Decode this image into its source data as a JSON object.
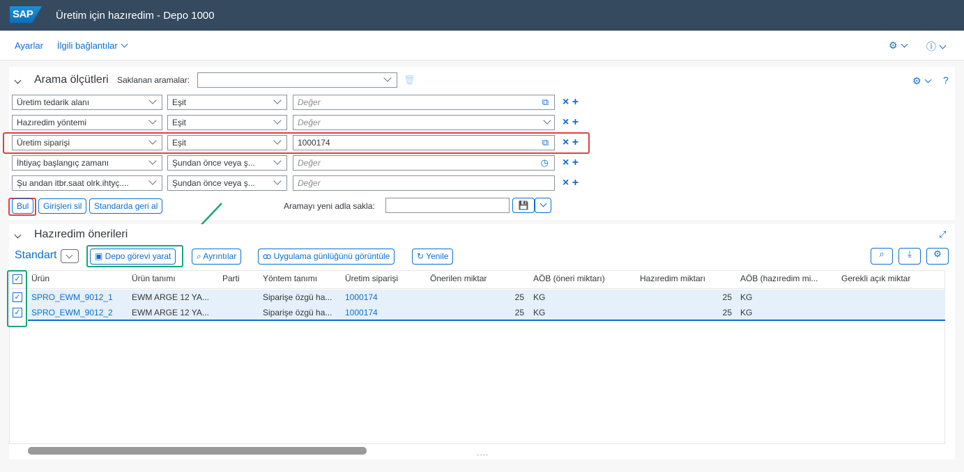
{
  "shell": {
    "logo": "SAP",
    "title": "Üretim için hazıredim - Depo 1000"
  },
  "menu": {
    "settings": "Ayarlar",
    "related": "İlgili bağlantılar"
  },
  "filter": {
    "title": "Arama ölçütleri",
    "saved_label": "Saklanan aramalar:",
    "rows": [
      {
        "field": "Üretim tedarik alanı",
        "op": "Eşit",
        "value": "",
        "placeholder": "Değer"
      },
      {
        "field": "Hazıredim yöntemi",
        "op": "Eşit",
        "value": "",
        "placeholder": "Değer"
      },
      {
        "field": "Üretim siparişi",
        "op": "Eşit",
        "value": "1000174",
        "placeholder": ""
      },
      {
        "field": "İhtiyaç başlangıç zamanı",
        "op": "Şundan önce veya ş...",
        "value": "",
        "placeholder": "Değer"
      },
      {
        "field": "Şu andan itbr.saat olrk.ihtyç....",
        "op": "Şundan önce veya ş...",
        "value": "",
        "placeholder": "Değer"
      }
    ],
    "find_btn": "Bul",
    "clear_btn": "Girişleri sil",
    "reset_btn": "Standarda geri al",
    "save_as_label": "Aramayı yeni adla sakla:"
  },
  "results": {
    "title": "Hazıredim önerileri",
    "variant": "Standart",
    "buttons": {
      "create": "Depo görevi yarat",
      "details": "Ayrıntılar",
      "log": "Uygulama günlüğünü görüntüle",
      "refresh": "Yenile"
    },
    "columns": [
      "Ürün",
      "Ürün tanımı",
      "Parti",
      "Yöntem tanımı",
      "Üretim siparişi",
      "Önerilen miktar",
      "AÖB (öneri miktarı)",
      "Hazıredim miktarı",
      "AÖB (hazıredim mi...",
      "Gerekli açık miktar"
    ],
    "rows": [
      {
        "product": "SPRO_EWM_9012_1",
        "desc": "EWM ARGE 12 YA...",
        "batch": "",
        "method": "Siparişe özgü ha...",
        "order": "1000174",
        "proposed": "25",
        "uom1": "KG",
        "staged": "25",
        "uom2": "KG",
        "open": ""
      },
      {
        "product": "SPRO_EWM_9012_2",
        "desc": "EWM ARGE 12 YA...",
        "batch": "",
        "method": "Siparişe özgü ha...",
        "order": "1000174",
        "proposed": "25",
        "uom1": "KG",
        "staged": "25",
        "uom2": "KG",
        "open": ""
      }
    ]
  },
  "colors": {
    "shell": "#354a5f",
    "accent": "#0a6ed1",
    "highlight_red": "#e04040",
    "highlight_green": "#1aa37a",
    "selected_row": "#e5f0fa"
  },
  "icons": {
    "copy": "copy-icon",
    "chevron": "chevron-down-icon",
    "clock": "history-icon",
    "delete": "trash-icon",
    "save": "save-icon",
    "search": "search-icon",
    "download": "download-icon",
    "settings": "gear-icon",
    "help": "help-icon",
    "fullscreen": "fullscreen-icon"
  }
}
